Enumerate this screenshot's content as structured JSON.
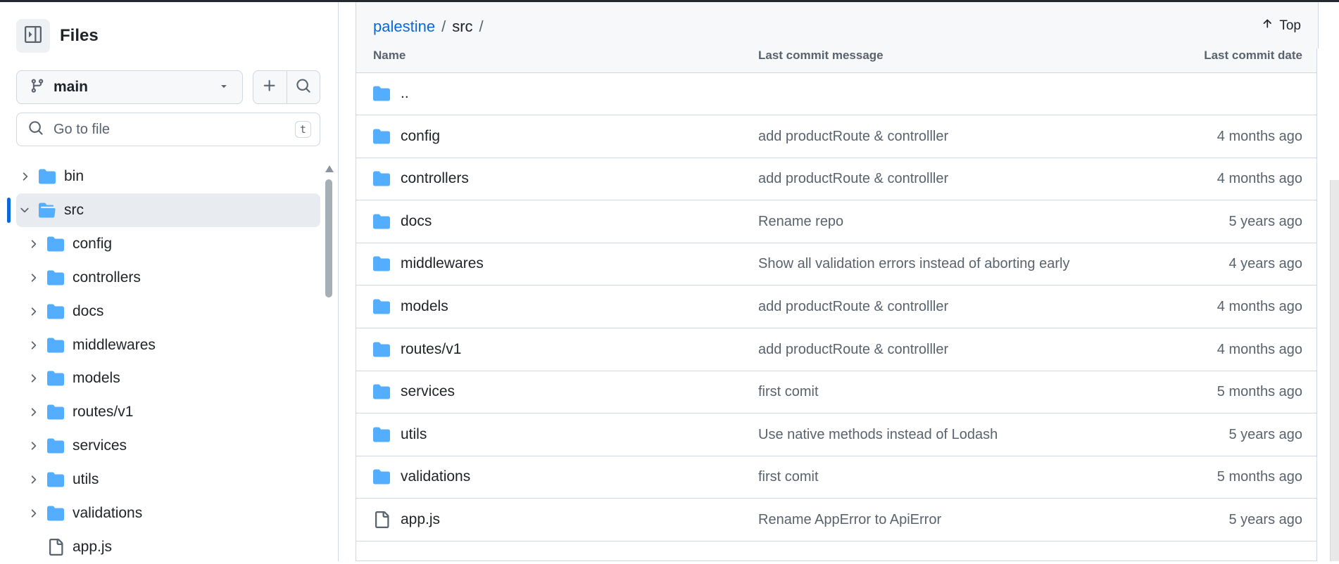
{
  "sidebar": {
    "title": "Files",
    "branch": "main",
    "search": {
      "placeholder": "Go to file",
      "shortcut": "t"
    },
    "tree": [
      {
        "name": "bin",
        "type": "folder",
        "level": 0,
        "expanded": false,
        "selected": false
      },
      {
        "name": "src",
        "type": "folder",
        "level": 0,
        "expanded": true,
        "selected": true
      },
      {
        "name": "config",
        "type": "folder",
        "level": 1,
        "expanded": false,
        "selected": false
      },
      {
        "name": "controllers",
        "type": "folder",
        "level": 1,
        "expanded": false,
        "selected": false
      },
      {
        "name": "docs",
        "type": "folder",
        "level": 1,
        "expanded": false,
        "selected": false
      },
      {
        "name": "middlewares",
        "type": "folder",
        "level": 1,
        "expanded": false,
        "selected": false
      },
      {
        "name": "models",
        "type": "folder",
        "level": 1,
        "expanded": false,
        "selected": false
      },
      {
        "name": "routes/v1",
        "type": "folder",
        "level": 1,
        "expanded": false,
        "selected": false
      },
      {
        "name": "services",
        "type": "folder",
        "level": 1,
        "expanded": false,
        "selected": false
      },
      {
        "name": "utils",
        "type": "folder",
        "level": 1,
        "expanded": false,
        "selected": false
      },
      {
        "name": "validations",
        "type": "folder",
        "level": 1,
        "expanded": false,
        "selected": false
      },
      {
        "name": "app.js",
        "type": "file",
        "level": 1,
        "expanded": false,
        "selected": false
      }
    ]
  },
  "breadcrumb": {
    "repo": "palestine",
    "sep": "/",
    "current": "src",
    "trailing": "/"
  },
  "top_label": "Top",
  "table": {
    "headers": {
      "name": "Name",
      "message": "Last commit message",
      "date": "Last commit date"
    },
    "rows": [
      {
        "name": "..",
        "type": "folder",
        "message": "",
        "date": ""
      },
      {
        "name": "config",
        "type": "folder",
        "message": "add productRoute & controlller",
        "date": "4 months ago"
      },
      {
        "name": "controllers",
        "type": "folder",
        "message": "add productRoute & controlller",
        "date": "4 months ago"
      },
      {
        "name": "docs",
        "type": "folder",
        "message": "Rename repo",
        "date": "5 years ago"
      },
      {
        "name": "middlewares",
        "type": "folder",
        "message": "Show all validation errors instead of aborting early",
        "date": "4 years ago"
      },
      {
        "name": "models",
        "type": "folder",
        "message": "add productRoute & controlller",
        "date": "4 months ago"
      },
      {
        "name": "routes/v1",
        "type": "folder",
        "message": "add productRoute & controlller",
        "date": "4 months ago"
      },
      {
        "name": "services",
        "type": "folder",
        "message": "first comit",
        "date": "5 months ago"
      },
      {
        "name": "utils",
        "type": "folder",
        "message": "Use native methods instead of Lodash",
        "date": "5 years ago"
      },
      {
        "name": "validations",
        "type": "folder",
        "message": "first comit",
        "date": "5 months ago"
      },
      {
        "name": "app.js",
        "type": "file",
        "message": "Rename AppError to ApiError",
        "date": "5 years ago"
      }
    ]
  },
  "colors": {
    "folder": "#54aeff",
    "link": "#0969da",
    "accent": "#0969da",
    "muted": "#59636e",
    "border": "#d0d7de"
  },
  "icons": {
    "sidebar_toggle": "sidebar-collapse-icon",
    "branch": "git-branch-icon",
    "dropdown": "triangle-down-icon",
    "add": "plus-icon",
    "search": "search-icon",
    "folder": "folder-icon",
    "folder_open": "folder-open-icon",
    "file": "file-icon",
    "chevron_right": "chevron-right-icon",
    "chevron_down": "chevron-down-icon",
    "arrow_up": "arrow-up-icon"
  }
}
